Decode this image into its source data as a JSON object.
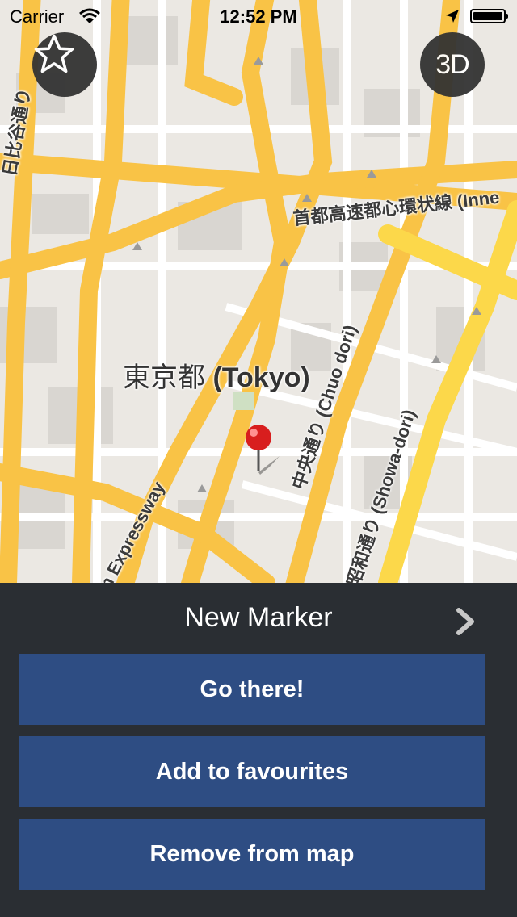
{
  "status_bar": {
    "carrier": "Carrier",
    "time": "12:52 PM",
    "icons": [
      "wifi-icon",
      "location-arrow-icon",
      "battery-icon"
    ]
  },
  "map": {
    "favourites_button_icon": "star-icon",
    "view_toggle_label": "3D",
    "labels": {
      "city_jp": "東京都",
      "city_en": "(Tokyo)",
      "hibiya": "日比谷通り",
      "shuto": "首都高速都心環状線 (Inne",
      "chuo": "中央通り (Chuo dori)",
      "showa": "昭和通り (Showa-dori)",
      "expressway": "n Expressway"
    },
    "marker_icon": "red-pin-icon",
    "colors": {
      "major_road": "#f9c346",
      "expressway": "#fcd04a",
      "land": "#ebe8e3",
      "block": "#dcd9d4"
    }
  },
  "panel": {
    "title": "New Marker",
    "detail_icon": "chevron-right-icon",
    "buttons": [
      "Go there!",
      "Add to favourites",
      "Remove from map"
    ],
    "colors": {
      "background": "#2a2e33",
      "button": "#2e4d83"
    }
  }
}
